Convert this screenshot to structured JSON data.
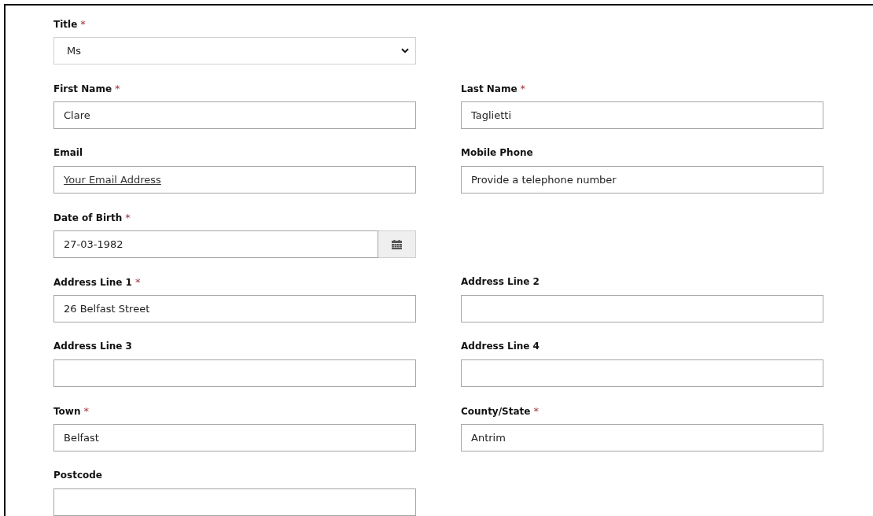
{
  "rows": [
    {
      "fields": [
        {
          "label": "Title",
          "required_mark": "*",
          "kind": "select",
          "value": "Ms"
        }
      ]
    },
    {
      "fields": [
        {
          "label": "First Name",
          "required_mark": "*",
          "kind": "text",
          "value": "Clare"
        },
        {
          "label": "Last Name",
          "required_mark": "*",
          "kind": "text",
          "value": "Taglietti"
        }
      ]
    },
    {
      "fields": [
        {
          "label": "Email",
          "kind": "link",
          "value": "Your Email Address"
        },
        {
          "label": "Mobile Phone",
          "kind": "text",
          "value": "Provide a telephone number"
        }
      ]
    },
    {
      "fields": [
        {
          "label": "Date of Birth",
          "required_mark": "*",
          "kind": "date",
          "value": "27-03-1982"
        }
      ]
    },
    {
      "fields": [
        {
          "label": "Address Line 1",
          "required_mark": "*",
          "kind": "text",
          "value": "26 Belfast Street"
        },
        {
          "label": "Address Line 2",
          "kind": "text"
        }
      ]
    },
    {
      "fields": [
        {
          "label": "Address Line 3",
          "kind": "text"
        },
        {
          "label": "Address Line 4",
          "kind": "text"
        }
      ]
    },
    {
      "fields": [
        {
          "label": "Town",
          "required_mark": "*",
          "kind": "text",
          "value": "Belfast"
        },
        {
          "label": "County/State",
          "required_mark": "*",
          "kind": "text",
          "value": "Antrim"
        }
      ]
    },
    {
      "fields": [
        {
          "label": "Postcode",
          "kind": "text"
        }
      ]
    }
  ]
}
